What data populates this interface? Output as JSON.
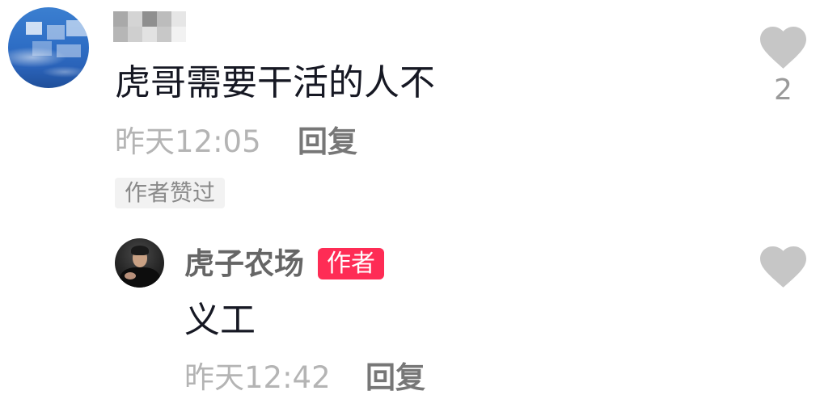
{
  "comment": {
    "avatar_icon": "sky-avatar",
    "text": "虎哥需要干活的人不",
    "time": "昨天12:05",
    "reply_label": "回复",
    "badge": "作者赞过",
    "like_icon": "heart-icon",
    "like_count": "2"
  },
  "reply": {
    "avatar_icon": "person-avatar",
    "username": "虎子农场",
    "author_tag": "作者",
    "text": "义工",
    "time": "昨天12:42",
    "reply_label": "回复",
    "like_icon": "heart-icon"
  },
  "colors": {
    "text_primary": "#161823",
    "text_secondary": "#b4b4b4",
    "reply_label": "#777777",
    "badge_bg": "#f2f2f2",
    "author_tag": "#fe2c55",
    "heart": "#c6c6c6"
  }
}
